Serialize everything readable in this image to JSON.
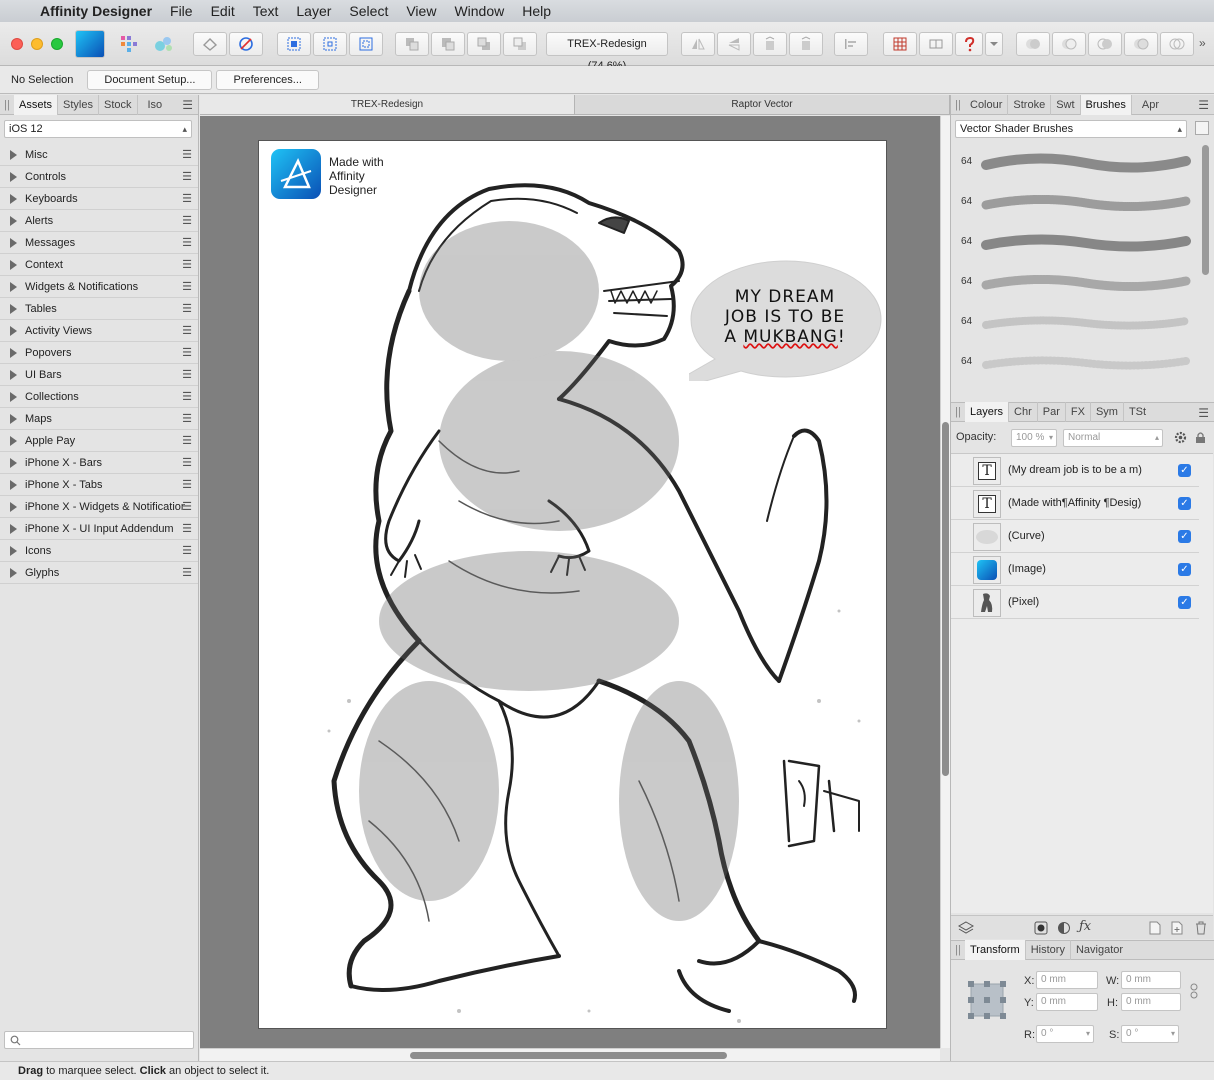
{
  "menubar": {
    "app": "Affinity Designer",
    "items": [
      "File",
      "Edit",
      "Text",
      "Layer",
      "Select",
      "View",
      "Window",
      "Help"
    ]
  },
  "toolbar": {
    "document": "TREX-Redesign (74.6%)"
  },
  "context": {
    "selection": "No Selection",
    "document_setup": "Document Setup...",
    "preferences": "Preferences..."
  },
  "left_panel": {
    "tabs": [
      "Assets",
      "Styles",
      "Stock",
      "Iso"
    ],
    "active_tab": "Assets",
    "set": "iOS 12",
    "categories": [
      "Misc",
      "Controls",
      "Keyboards",
      "Alerts",
      "Messages",
      "Context",
      "Widgets & Notifications",
      "Tables",
      "Activity Views",
      "Popovers",
      "UI Bars",
      "Collections",
      "Maps",
      "Apple Pay",
      "iPhone X - Bars",
      "iPhone X - Tabs",
      "iPhone X - Widgets & Notifications",
      "iPhone X - UI Input Addendum",
      "Icons",
      "Glyphs"
    ]
  },
  "document_tabs": [
    "TREX-Redesign",
    "Raptor Vector"
  ],
  "artboard": {
    "made_with": [
      "Made with",
      "Affinity",
      "Designer"
    ],
    "speech_bubble": [
      "MY DREAM",
      "JOB IS TO BE",
      "A ",
      "MUKBANG",
      "!"
    ]
  },
  "brushes_panel": {
    "tabs": [
      "Colour",
      "Stroke",
      "Swt",
      "Brushes",
      "Apr"
    ],
    "active_tab": "Brushes",
    "category": "Vector Shader Brushes",
    "brush_sizes": [
      "64",
      "64",
      "64",
      "64",
      "64",
      "64"
    ]
  },
  "layers_panel": {
    "tabs": [
      "Layers",
      "Chr",
      "Par",
      "FX",
      "Sym",
      "TSt"
    ],
    "active_tab": "Layers",
    "opacity_label": "Opacity:",
    "opacity_value": "100 %",
    "blend_mode": "Normal",
    "layers": [
      {
        "name": "(My dream job is to be a m)",
        "thumb": "T"
      },
      {
        "name": "(Made with¶Affinity ¶Desig)",
        "thumb": "T"
      },
      {
        "name": "(Curve)",
        "thumb": ""
      },
      {
        "name": "(Image)",
        "thumb": ""
      },
      {
        "name": "(Pixel)",
        "thumb": ""
      }
    ]
  },
  "transform_panel": {
    "tabs": [
      "Transform",
      "History",
      "Navigator"
    ],
    "active_tab": "Transform",
    "x_label": "X:",
    "y_label": "Y:",
    "w_label": "W:",
    "h_label": "H:",
    "r_label": "R:",
    "s_label": "S:",
    "x": "0 mm",
    "y": "0 mm",
    "w": "0 mm",
    "h": "0 mm",
    "r": "0 °",
    "s": "0 °"
  },
  "status": {
    "drag": "Drag",
    "drag_text": " to marquee select. ",
    "click": "Click",
    "click_text": " an object to select it."
  }
}
